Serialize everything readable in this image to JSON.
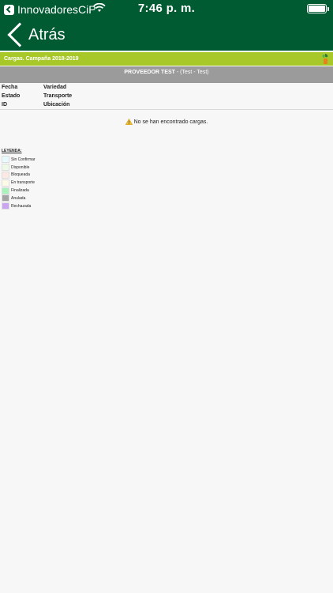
{
  "status_bar": {
    "back_app": "InnovadoresCiP",
    "time": "7:46 p. m."
  },
  "nav": {
    "back_label": "Atrás"
  },
  "header_bar": {
    "title": "Cargas. Campaña 2018-2019"
  },
  "provider": {
    "name": "PROVEEDOR TEST",
    "detail": " - (Test - Test)"
  },
  "table_headers": [
    {
      "left": "Fecha",
      "right": "Variedad"
    },
    {
      "left": "Estado",
      "right": "Transporte"
    },
    {
      "left": "ID",
      "right": "Ubicación"
    }
  ],
  "empty_message": "No se han encontrado cargas.",
  "legend": {
    "title": "LEYENDA:",
    "items": [
      {
        "label": "Sin Confirmar",
        "color": "#e8fbfc"
      },
      {
        "label": "Disponible",
        "color": "#eef9e8"
      },
      {
        "label": "Bloqueada",
        "color": "#fde9e3"
      },
      {
        "label": "En transporte",
        "color": "#fdfbe6"
      },
      {
        "label": "Finalizada",
        "color": "#a9f2ba"
      },
      {
        "label": "Anulada",
        "color": "#a3a3a3"
      },
      {
        "label": "Rechazada",
        "color": "#c9a4f1"
      }
    ]
  },
  "colors": {
    "topbar": "#005a32",
    "accent_bar": "#a8c82a",
    "provider_bar": "#9b9b9b"
  }
}
